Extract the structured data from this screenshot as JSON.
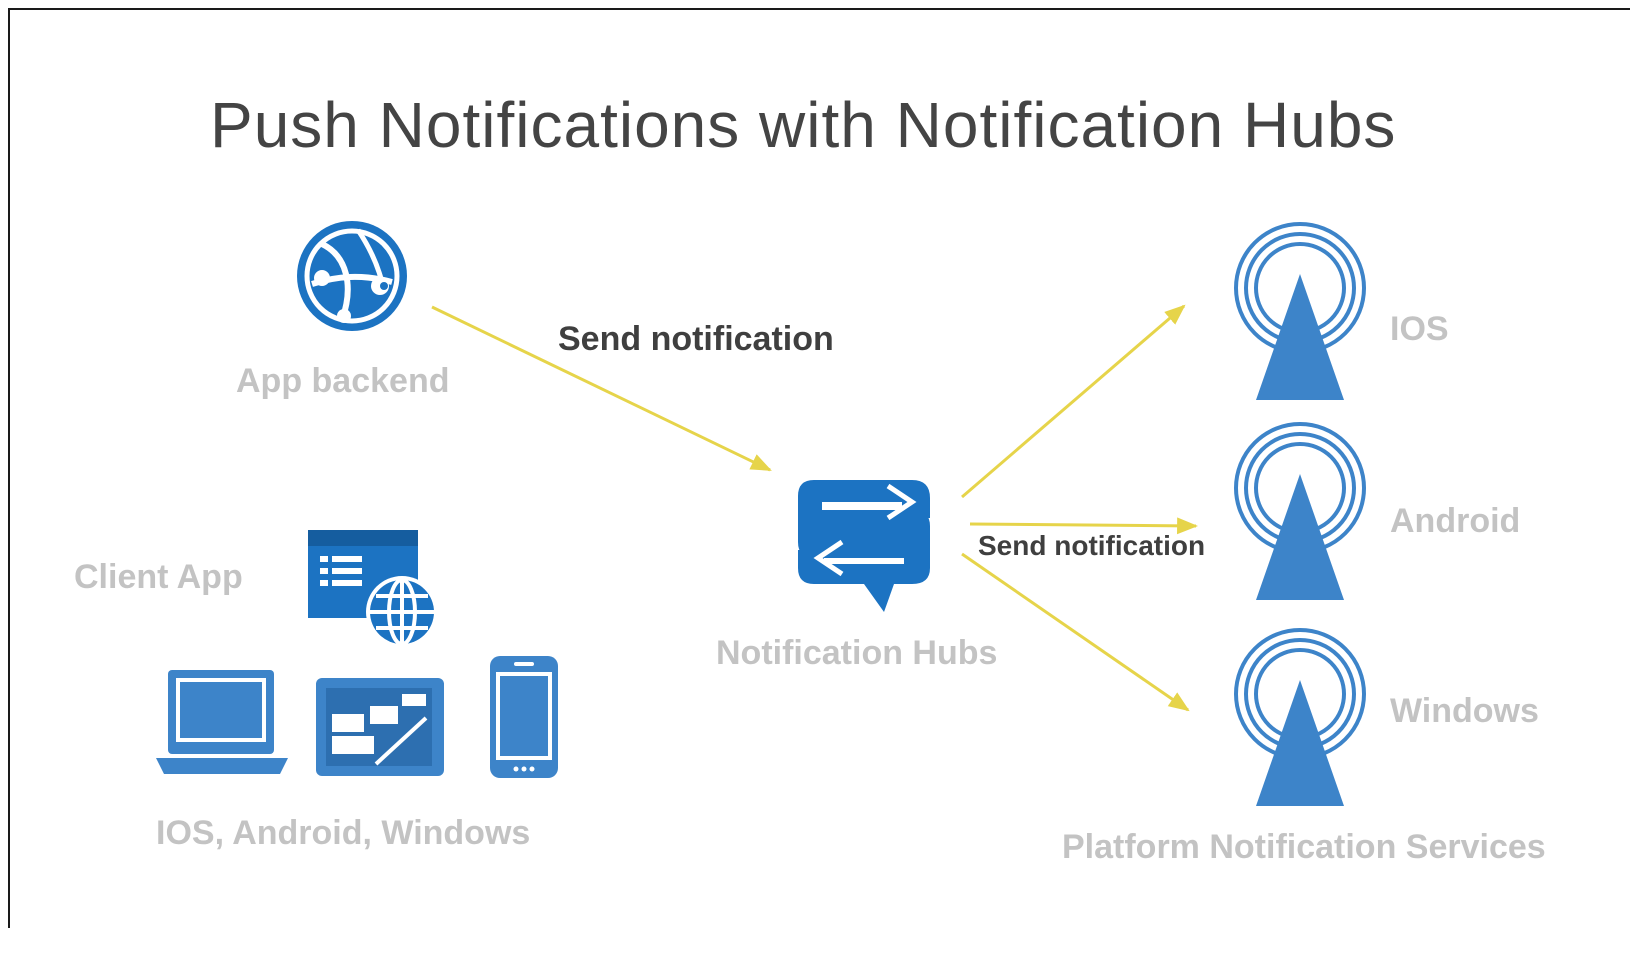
{
  "title": "Push Notifications with Notification Hubs",
  "labels": {
    "app_backend": "App backend",
    "send_notification_1": "Send notification",
    "send_notification_2": "Send notification",
    "client_app": "Client App",
    "notification_hubs": "Notification Hubs",
    "client_platforms": "IOS, Android, Windows",
    "ios": "IOS",
    "android": "Android",
    "windows": "Windows",
    "platform_services": "Platform Notification Services"
  },
  "colors": {
    "icon_blue": "#1c73c2",
    "tower_blue": "#3d84c9",
    "arrow_yellow": "#e6d44a",
    "label_gray": "#c3c3c3",
    "title_gray": "#444444",
    "text_dark": "#3f3f3f"
  },
  "icons": [
    "globe-network-icon",
    "client-app-icon",
    "laptop-icon",
    "tablet-icon",
    "phone-icon",
    "notification-hub-icon",
    "broadcast-tower-icon"
  ]
}
